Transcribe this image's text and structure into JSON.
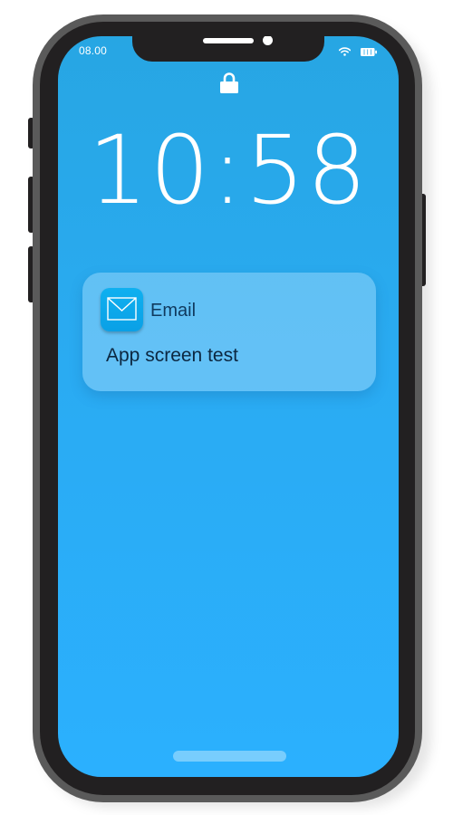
{
  "status_bar": {
    "time": "08.00",
    "wifi_icon": "wifi-icon",
    "battery_icon": "battery-icon"
  },
  "lock_screen": {
    "lock_icon": "lock-icon",
    "clock": "10:58"
  },
  "notification": {
    "app_icon": "envelope-icon",
    "app_name": "Email",
    "message": "App screen test"
  },
  "colors": {
    "screen_top": "#27a6e3",
    "screen_bottom": "#2bb0fe",
    "phone_frame": "#222021",
    "phone_outer": "#5a5a5a",
    "app_icon": "#0aa0e6"
  }
}
